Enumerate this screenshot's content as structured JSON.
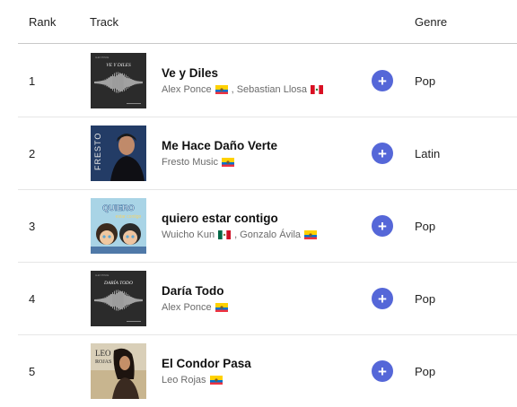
{
  "header": {
    "rank": "Rank",
    "track": "Track",
    "genre": "Genre"
  },
  "tracks": [
    {
      "rank": "1",
      "title": "Ve y Diles",
      "artists": [
        {
          "name": "Alex Ponce",
          "flag": "ecuador"
        },
        {
          "name": "Sebastian Llosa",
          "flag": "peru"
        }
      ],
      "genre": "Pop",
      "cover": {
        "style": "waveform-dark",
        "text": "VE Y DILES"
      }
    },
    {
      "rank": "2",
      "title": "Me Hace Daño Verte",
      "artists": [
        {
          "name": "Fresto Music",
          "flag": "ecuador"
        }
      ],
      "genre": "Latin",
      "cover": {
        "style": "portrait-blue",
        "text": "FRESTO"
      }
    },
    {
      "rank": "3",
      "title": "quiero estar contigo",
      "artists": [
        {
          "name": "Wuicho Kun",
          "flag": "mexico"
        },
        {
          "name": "Gonzalo Ávila",
          "flag": "ecuador"
        }
      ],
      "genre": "Pop",
      "cover": {
        "style": "cartoon",
        "text": "QUIERO"
      }
    },
    {
      "rank": "4",
      "title": "Daría Todo",
      "artists": [
        {
          "name": "Alex Ponce",
          "flag": "ecuador"
        }
      ],
      "genre": "Pop",
      "cover": {
        "style": "waveform-dark",
        "text": "DARÍA TODO"
      }
    },
    {
      "rank": "5",
      "title": "El Condor Pasa",
      "artists": [
        {
          "name": "Leo Rojas",
          "flag": "ecuador"
        }
      ],
      "genre": "Pop",
      "cover": {
        "style": "portrait-warm",
        "text": "LEO ROJAS"
      }
    }
  ],
  "colors": {
    "accent": "#5567d8",
    "divider": "#c9c9c9",
    "secondary_text": "#6b6b6b"
  },
  "icons": {
    "add": "plus-icon"
  },
  "add_label": "+"
}
